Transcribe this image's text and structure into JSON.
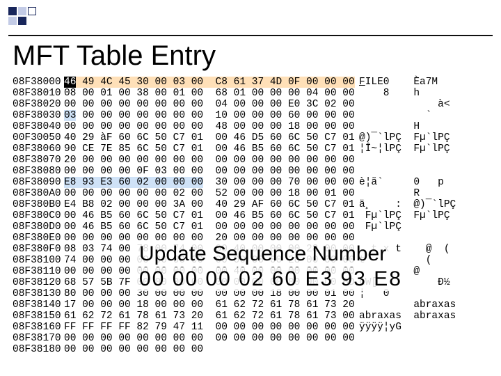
{
  "title": "MFT Table Entry",
  "callout": {
    "label": "Update Sequence Number",
    "value": "00 00 00 02 60 E3 93 E8"
  },
  "hex": {
    "offsets": [
      "08F38000",
      "08F38010",
      "08F38020",
      "08F38030",
      "08F38040",
      "00F30050",
      "08F38060",
      "08F38070",
      "08F38080",
      "08F38090",
      "08F380A0",
      "08F380B0",
      "08F380C0",
      "08F380D0",
      "08F380E0",
      "08F380F0",
      "08F38100",
      "08F38110",
      "08F38120",
      "08F38130",
      "08F38140",
      "08F38150",
      "08F38160",
      "08F38170",
      "08F38180"
    ],
    "bytes": [
      "46 49 4C 45 30 00 03 00  C8 61 37 4D 0F 00 00 00",
      "08 00 01 00 38 00 01 00  68 01 00 00 00 04 00 00",
      "00 00 00 00 00 00 00 00  04 00 00 00 E0 3C 02 00",
      "03 00 00 00 00 00 00 00  10 00 00 00 60 00 00 00",
      "00 00 00 00 00 00 00 00  48 00 00 00 18 00 00 00",
      "40 29 àF 60 6C 50 C7 01  00 46 D5 60 6C 50 C7 01",
      "90 CE 7E 85 6C 50 C7 01  00 46 B5 60 6C 50 C7 01",
      "20 00 00 00 00 00 00 00  00 00 00 00 00 00 00 00",
      "00 00 00 00 0F 03 00 00  00 00 00 00 00 00 00 00",
      "E8 93 E3 60 02 00 00 00  30 00 00 00 70 00 00 00",
      "00 00 00 00 00 00 02 00  52 00 00 00 18 00 01 00",
      "E4 B8 02 00 00 00 3A 00  40 29 AF 60 6C 50 C7 01",
      "00 46 B5 60 6C 50 C7 01  00 46 B5 60 6C 50 C7 01",
      "00 46 B5 60 6C 50 C7 01  00 00 00 00 00 00 00 00",
      "00 00 00 00 00 00 00 00  20 00 00 00 00 00 00 00",
      "08 03 74 00 78 00 74 00  00 40 00 00 00 28 00 00",
      "74 00 00 00 00 00 00 00  00 00 00 00 28 00 00 00",
      "00 00 00 00 00 00 00 00  00 40 00 00 00 00 00 00",
      "68 57 5B 7F 00 00 00 00  00 00 00 00 00 00 D0 BD",
      "80 00 00 00 30 00 00 00  00 00 00 18 00 00 01 00",
      "17 00 00 00 18 00 00 00  61 62 72 61 78 61 73 20",
      "61 62 72 61 78 61 73 20  61 62 72 61 78 61 73 00",
      "FF FF FF FF 82 79 47 11  00 00 00 00 00 00 00 00",
      "00 00 00 00 00 00 00 00  00 00 00 00 00 00 00 00",
      "00 00 00 00 00 00 00 00"
    ],
    "ascii": [
      "FILE0    Èa7M",
      "    8    h",
      "             à<",
      "           `",
      "         H",
      "@)¯`lPÇ  Fµ`lPÇ",
      "¦Î~¦lPÇ  Fµ`lPÇ",
      "",
      "",
      "è¦ã`     0   p",
      "         R",
      "ä¸    :  @)¯`lPÇ",
      " Fµ`lPÇ  Fµ`lPÇ",
      " Fµ`lPÇ",
      "",
      "  t x t    @  (",
      "t          (",
      "         @",
      "hW[          Ð½",
      "¦   0",
      "         abraxas",
      "abraxas  abraxas",
      "ÿÿÿÿ¦yG",
      "",
      ""
    ]
  }
}
